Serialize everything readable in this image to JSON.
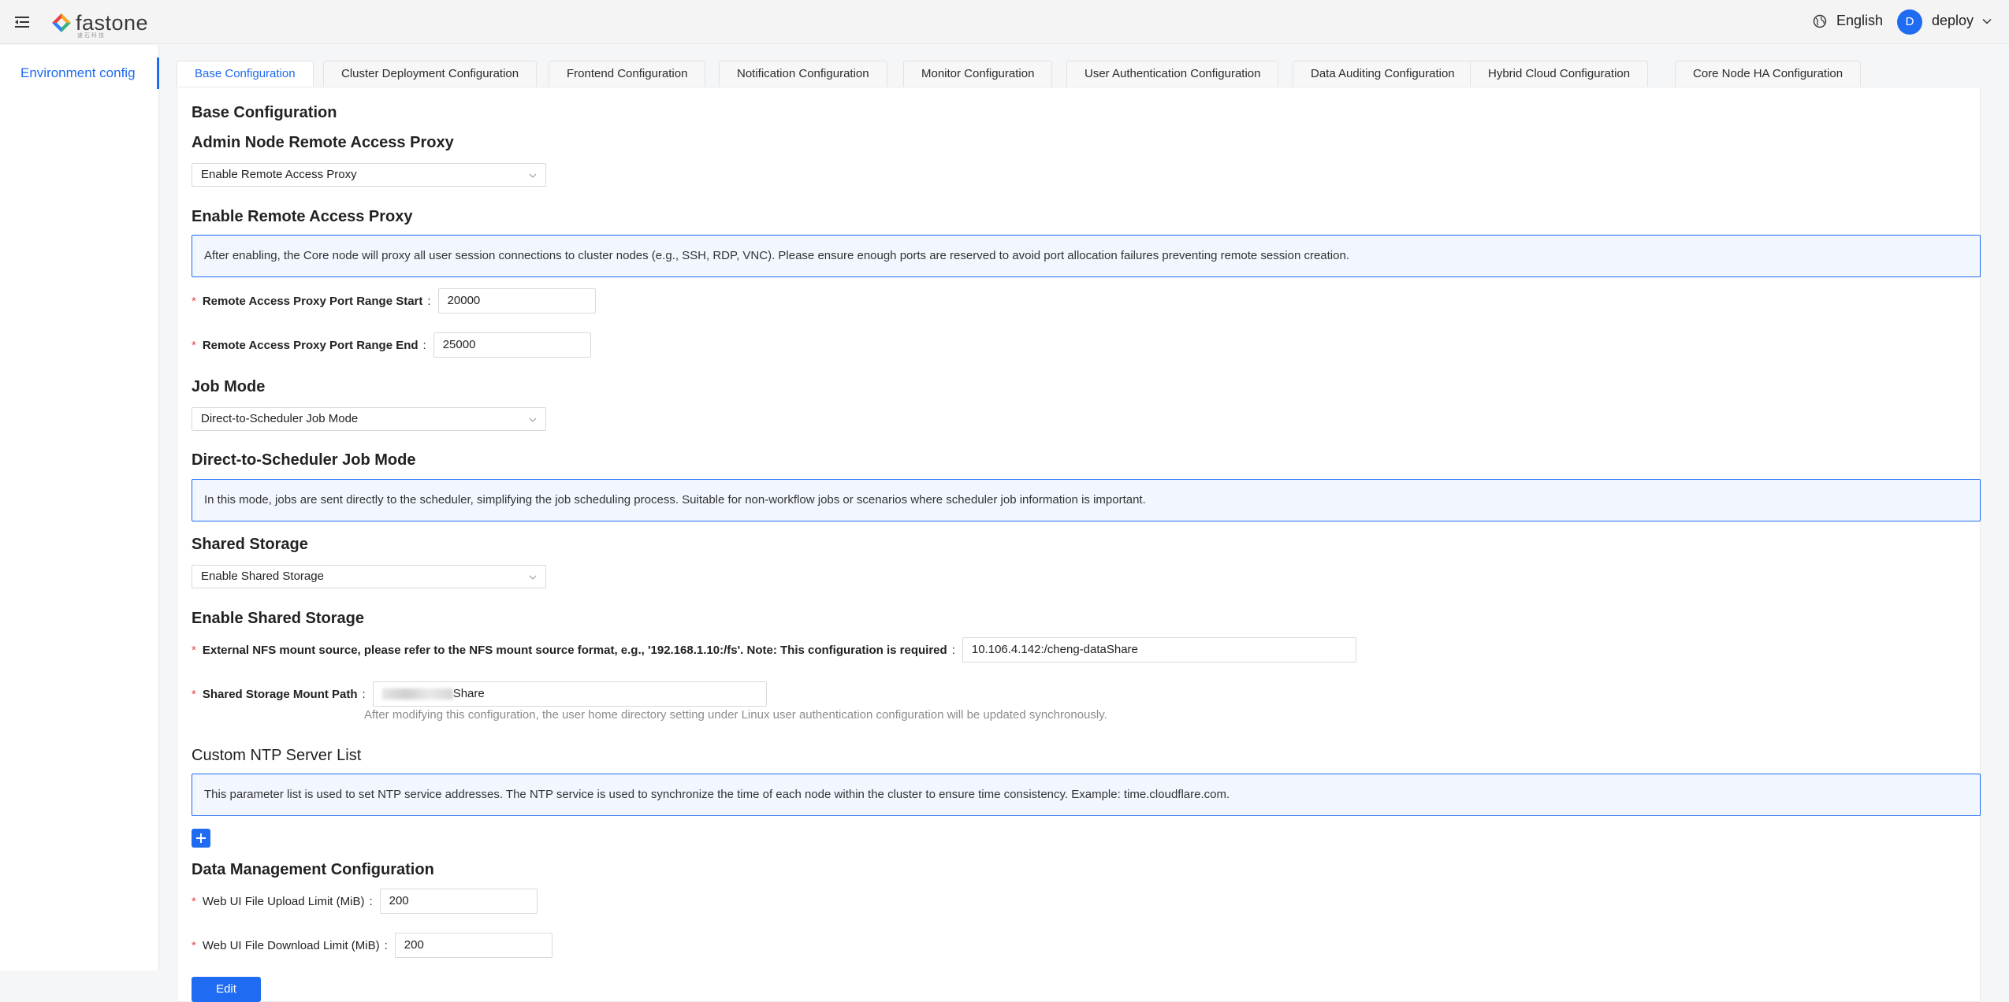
{
  "header": {
    "logo_text": "fastone",
    "logo_sub": "速石科技",
    "language": "English",
    "user_initial": "D",
    "user_name": "deploy"
  },
  "sidebar": {
    "items": [
      {
        "label": "Environment config",
        "active": true
      }
    ]
  },
  "tabs": [
    {
      "label": "Base Configuration",
      "active": true
    },
    {
      "label": "Cluster Deployment Configuration"
    },
    {
      "label": "Frontend Configuration"
    },
    {
      "label": "Notification Configuration"
    },
    {
      "label": "Monitor Configuration"
    },
    {
      "label": "User Authentication Configuration"
    },
    {
      "label": "Data Auditing Configuration"
    },
    {
      "label": "Hybrid Cloud Configuration"
    },
    {
      "label": "Core Node HA Configuration"
    }
  ],
  "base": {
    "title": "Base Configuration",
    "proxy": {
      "title": "Admin Node Remote Access Proxy",
      "selected": "Enable Remote Access Proxy",
      "detail_title": "Enable Remote Access Proxy",
      "info": "After enabling, the Core node will proxy all user session connections to cluster nodes (e.g., SSH, RDP, VNC). Please ensure enough ports are reserved to avoid port allocation failures preventing remote session creation.",
      "port_start_label": "Remote Access Proxy Port Range Start",
      "port_start_value": "20000",
      "port_end_label": "Remote Access Proxy Port Range End",
      "port_end_value": "25000"
    },
    "job_mode": {
      "title": "Job Mode",
      "selected": "Direct-to-Scheduler Job Mode",
      "detail_title": "Direct-to-Scheduler Job Mode",
      "info": "In this mode, jobs are sent directly to the scheduler, simplifying the job scheduling process. Suitable for non-workflow jobs or scenarios where scheduler job information is important."
    },
    "storage": {
      "title": "Shared Storage",
      "selected": "Enable Shared Storage",
      "detail_title": "Enable Shared Storage",
      "nfs_label": "External NFS mount source, please refer to the NFS mount source format, e.g., '192.168.1.10:/fs'. Note: This configuration is required",
      "nfs_value": "10.106.4.142:/cheng-dataShare",
      "mount_label": "Shared Storage Mount Path",
      "mount_value_suffix": "Share",
      "mount_help": "After modifying this configuration, the user home directory setting under Linux user authentication configuration will be updated synchronously."
    },
    "ntp": {
      "title": "Custom NTP Server List",
      "info": "This parameter list is used to set NTP service addresses. The NTP service is used to synchronize the time of each node within the cluster to ensure time consistency. Example: time.cloudflare.com."
    },
    "data_mgmt": {
      "title": "Data Management Configuration",
      "upload_label": "Web UI File Upload Limit (MiB)",
      "upload_value": "200",
      "download_label": "Web UI File Download Limit (MiB)",
      "download_value": "200"
    },
    "edit_label": "Edit"
  },
  "colors": {
    "accent": "#1f6bf2",
    "required": "#e5484d",
    "info_bg": "#f1f6ff"
  },
  "icons": [
    "menu-fold-icon",
    "fastone-logo-icon",
    "globe-icon",
    "chevron-down-icon",
    "plus-icon"
  ]
}
